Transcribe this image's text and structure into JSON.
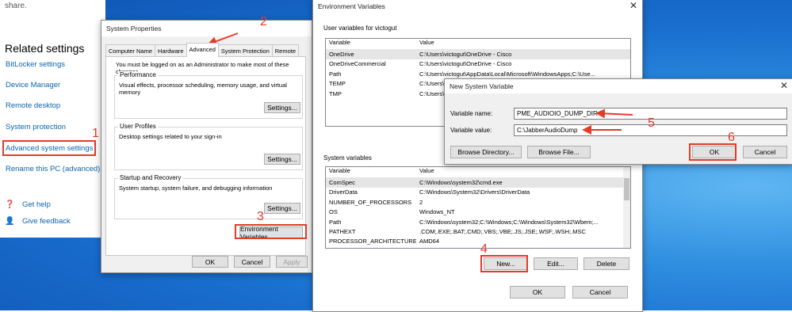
{
  "settings": {
    "share_text": "share.",
    "heading": "Related settings",
    "links": [
      "BitLocker settings",
      "Device Manager",
      "Remote desktop",
      "System protection",
      "Advanced system settings",
      "Rename this PC (advanced)"
    ],
    "get_help": "Get help",
    "give_feedback": "Give feedback"
  },
  "system_properties": {
    "title": "System Properties",
    "tabs": [
      "Computer Name",
      "Hardware",
      "Advanced",
      "System Protection",
      "Remote"
    ],
    "admin_note": "You must be logged on as an Administrator to make most of these changes.",
    "performance": {
      "title": "Performance",
      "desc": "Visual effects, processor scheduling, memory usage, and virtual memory",
      "button": "Settings..."
    },
    "user_profiles": {
      "title": "User Profiles",
      "desc": "Desktop settings related to your sign-in",
      "button": "Settings..."
    },
    "startup": {
      "title": "Startup and Recovery",
      "desc": "System startup, system failure, and debugging information",
      "button": "Settings..."
    },
    "env_button": "Environment Variables...",
    "ok": "OK",
    "cancel": "Cancel",
    "apply": "Apply"
  },
  "env_vars": {
    "title": "Environment Variables",
    "user_section": "User variables for victogut",
    "col_variable": "Variable",
    "col_value": "Value",
    "user_rows": [
      {
        "name": "OneDrive",
        "value": "C:\\Users\\victogut\\OneDrive - Cisco"
      },
      {
        "name": "OneDriveCommercial",
        "value": "C:\\Users\\victogut\\OneDrive - Cisco"
      },
      {
        "name": "Path",
        "value": "C:\\Users\\victogut\\AppData\\Local\\Microsoft\\WindowsApps;C:\\Use..."
      },
      {
        "name": "TEMP",
        "value": "C:\\Users\\"
      },
      {
        "name": "TMP",
        "value": "C:\\Users\\"
      }
    ],
    "system_section": "System variables",
    "system_rows": [
      {
        "name": "ComSpec",
        "value": "C:\\Windows\\system32\\cmd.exe"
      },
      {
        "name": "DriverData",
        "value": "C:\\Windows\\System32\\Drivers\\DriverData"
      },
      {
        "name": "NUMBER_OF_PROCESSORS",
        "value": "2"
      },
      {
        "name": "OS",
        "value": "Windows_NT"
      },
      {
        "name": "Path",
        "value": "C:\\Windows\\system32;C:\\Windows;C:\\Windows\\System32\\Wbem;..."
      },
      {
        "name": "PATHEXT",
        "value": ".COM;.EXE;.BAT;.CMD;.VBS;.VBE;.JS;.JSE;.WSF;.WSH;.MSC"
      },
      {
        "name": "PROCESSOR_ARCHITECTURE",
        "value": "AMD64"
      }
    ],
    "new_button": "New...",
    "edit_button": "Edit...",
    "delete_button": "Delete",
    "ok": "OK",
    "cancel": "Cancel"
  },
  "new_var": {
    "title": "New System Variable",
    "name_label": "Variable name:",
    "name_value": "PME_AUDIOIO_DUMP_DIR",
    "value_label": "Variable value:",
    "value_value": "C:\\JabberAudioDump",
    "browse_dir": "Browse Directory...",
    "browse_file": "Browse File...",
    "ok": "OK",
    "cancel": "Cancel"
  },
  "annotations": [
    "1",
    "2",
    "3",
    "4",
    "5",
    "6"
  ],
  "colors": {
    "annotation": "#e53a28",
    "link": "#0a64ad",
    "desktop": "#1a6fcf"
  }
}
